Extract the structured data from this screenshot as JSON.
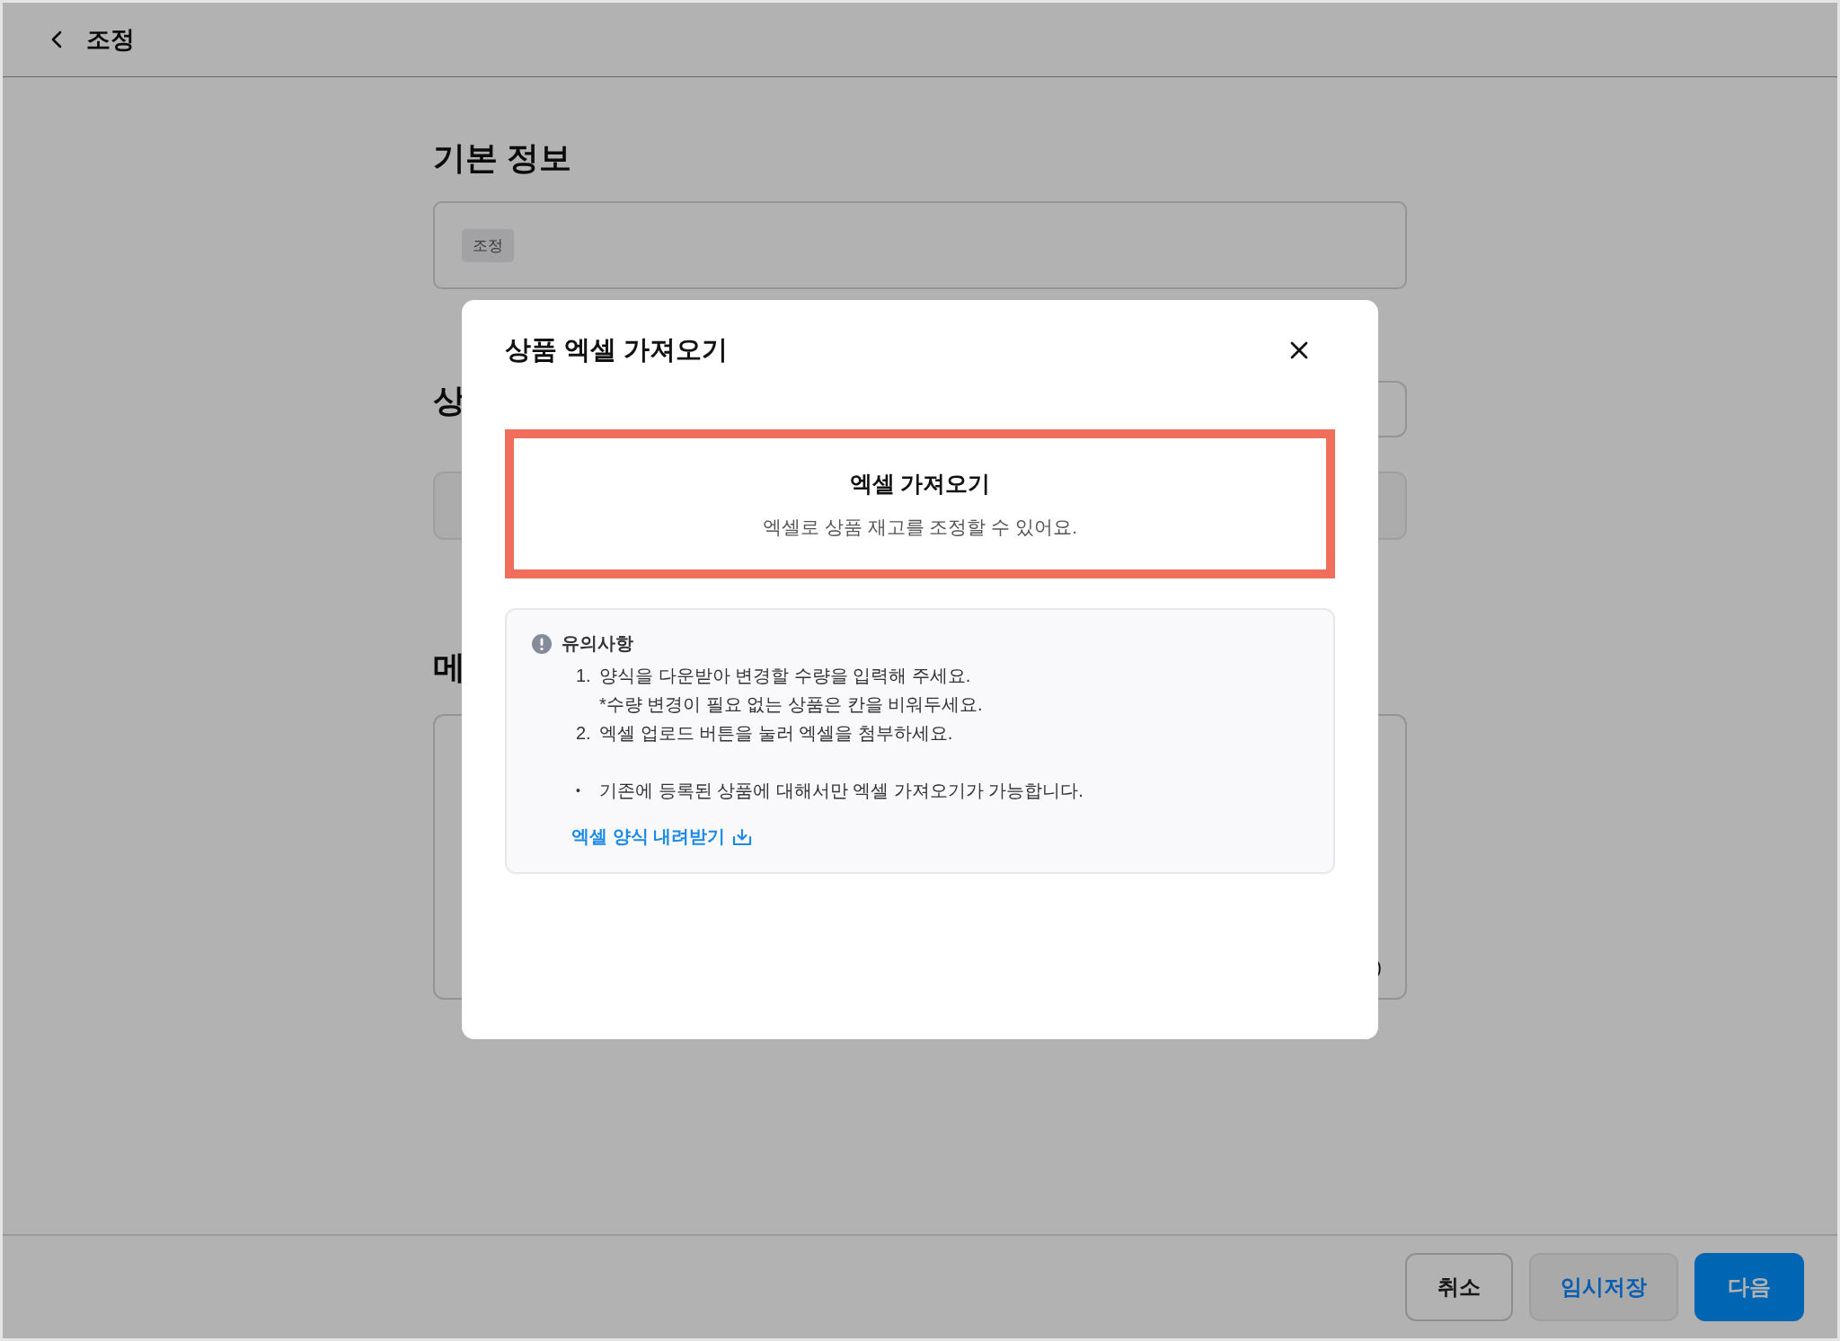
{
  "header": {
    "title": "조정"
  },
  "background": {
    "basic_info": {
      "heading": "기본 정보",
      "tag": "조정"
    },
    "section_2": {
      "heading": "상"
    },
    "section_3": {
      "heading": "메",
      "counter": ")"
    }
  },
  "footer_buttons": [
    {
      "label": "취소",
      "kind": "secondary"
    },
    {
      "label": "임시저장",
      "kind": "tertiary"
    },
    {
      "label": "다음",
      "kind": "primary"
    }
  ],
  "modal": {
    "title": "상품 엑셀 가져오기",
    "highlight": {
      "title": "엑셀 가져오기",
      "description": "엑셀로 상품 재고를 조정할 수 있어요."
    },
    "notice": {
      "title": "유의사항",
      "items": [
        {
          "kind": "numbered",
          "marker": "1.",
          "lines": [
            "양식을 다운받아 변경할 수량을 입력해 주세요.",
            "*수량 변경이 필요 없는 상품은 칸을 비워두세요."
          ]
        },
        {
          "kind": "numbered",
          "marker": "2.",
          "lines": [
            "엑셀 업로드 버튼을 눌러 엑셀을 첨부하세요."
          ]
        },
        {
          "kind": "bullet",
          "marker": "•",
          "lines": [
            "기존에 등록된 상품에 대해서만 엑셀 가져오기가 가능합니다."
          ]
        }
      ],
      "link": "엑셀 양식 내려받기"
    }
  }
}
